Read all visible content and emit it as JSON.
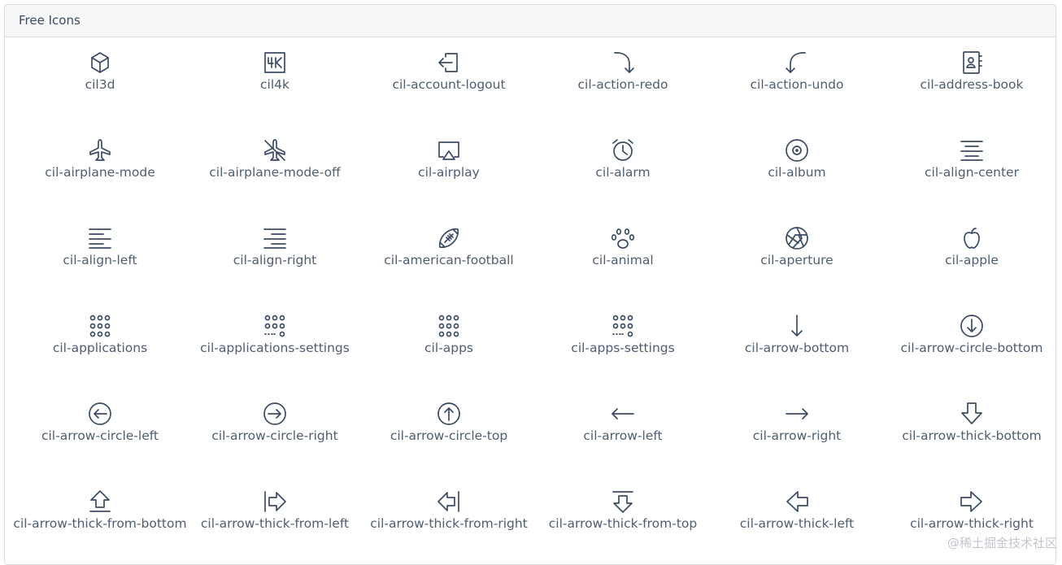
{
  "card": {
    "title": "Free Icons"
  },
  "icons": [
    "cil3d",
    "cil4k",
    "cil-account-logout",
    "cil-action-redo",
    "cil-action-undo",
    "cil-address-book",
    "cil-airplane-mode",
    "cil-airplane-mode-off",
    "cil-airplay",
    "cil-alarm",
    "cil-album",
    "cil-align-center",
    "cil-align-left",
    "cil-align-right",
    "cil-american-football",
    "cil-animal",
    "cil-aperture",
    "cil-apple",
    "cil-applications",
    "cil-applications-settings",
    "cil-apps",
    "cil-apps-settings",
    "cil-arrow-bottom",
    "cil-arrow-circle-bottom",
    "cil-arrow-circle-left",
    "cil-arrow-circle-right",
    "cil-arrow-circle-top",
    "cil-arrow-left",
    "cil-arrow-right",
    "cil-arrow-thick-bottom",
    "cil-arrow-thick-from-bottom",
    "cil-arrow-thick-from-left",
    "cil-arrow-thick-from-right",
    "cil-arrow-thick-from-top",
    "cil-arrow-thick-left",
    "cil-arrow-thick-right"
  ],
  "watermark": "@稀土掘金技术社区"
}
